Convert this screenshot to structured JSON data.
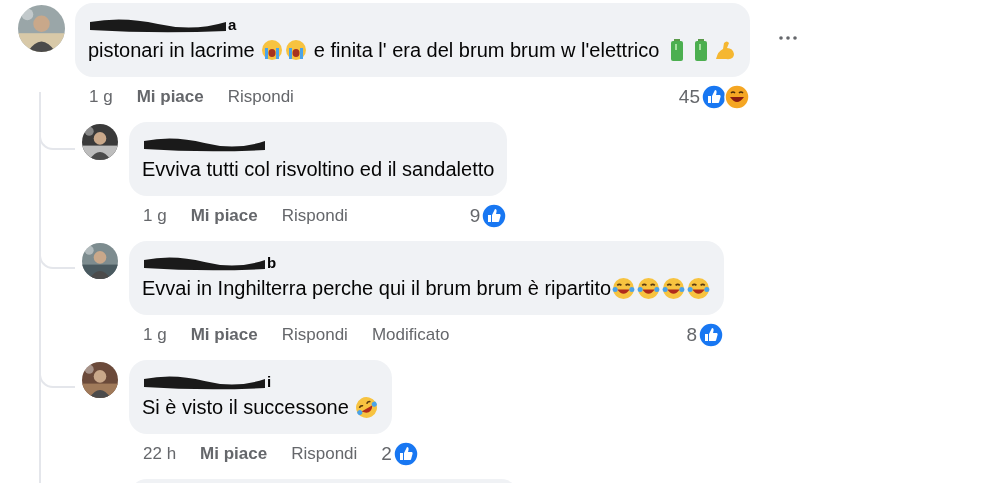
{
  "comment": {
    "name_tail": "a",
    "body": [
      {
        "kind": "text",
        "text": "pistonari in lacrime "
      },
      {
        "kind": "crying"
      },
      {
        "kind": "crying"
      },
      {
        "kind": "text",
        "text": " e finita l' era del brum brum w l'elettrico "
      },
      {
        "kind": "battery"
      },
      {
        "kind": "battery"
      },
      {
        "kind": "biceps"
      }
    ],
    "time": "1 g",
    "like": "Mi piace",
    "reply": "Rispondi",
    "count": "45",
    "reactions": [
      {
        "kind": "like"
      },
      {
        "kind": "haha"
      }
    ]
  },
  "replies": [
    {
      "body": [
        {
          "kind": "text",
          "text": "Evviva tutti col risvoltino ed il sandaletto"
        }
      ],
      "time": "1 g",
      "like": "Mi piace",
      "reply": "Rispondi",
      "count": "9",
      "reactions": [
        {
          "kind": "like"
        }
      ]
    },
    {
      "name_tail": "b",
      "body": [
        {
          "kind": "text",
          "text": "Evvai in Inghilterra perche qui il brum brum è ripartito"
        },
        {
          "kind": "joy"
        },
        {
          "kind": "joy"
        },
        {
          "kind": "joy"
        },
        {
          "kind": "joy"
        }
      ],
      "time": "1 g",
      "like": "Mi piace",
      "reply": "Rispondi",
      "edited": "Modificato",
      "count": "8",
      "reactions": [
        {
          "kind": "like"
        }
      ]
    },
    {
      "name_tail": "i",
      "body": [
        {
          "kind": "text",
          "text": "Si è visto il successone "
        },
        {
          "kind": "rofl"
        }
      ],
      "time": "22 h",
      "like": "Mi piace",
      "reply": "Rispondi",
      "count": "2",
      "reactions": [
        {
          "kind": "like"
        }
      ]
    }
  ]
}
